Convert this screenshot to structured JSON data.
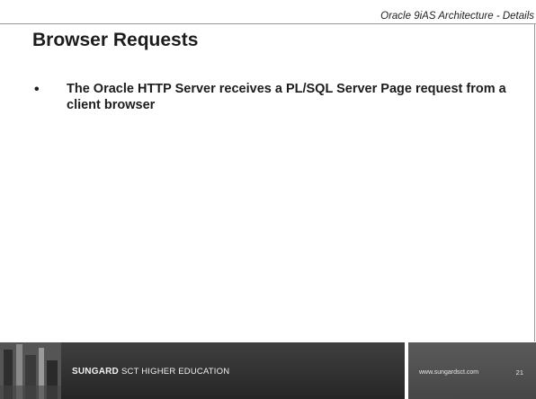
{
  "header": {
    "label": "Oracle 9iAS Architecture - Details"
  },
  "slide": {
    "title": "Browser Requests",
    "bullets": [
      {
        "marker": "•",
        "text": "The Oracle HTTP Server receives a PL/SQL Server Page request from a client browser"
      }
    ]
  },
  "footer": {
    "brand_strong": "SUNGARD",
    "brand_rest": "SCT HIGHER EDUCATION",
    "url": "www.sungardsct.com",
    "page_number": "21"
  }
}
